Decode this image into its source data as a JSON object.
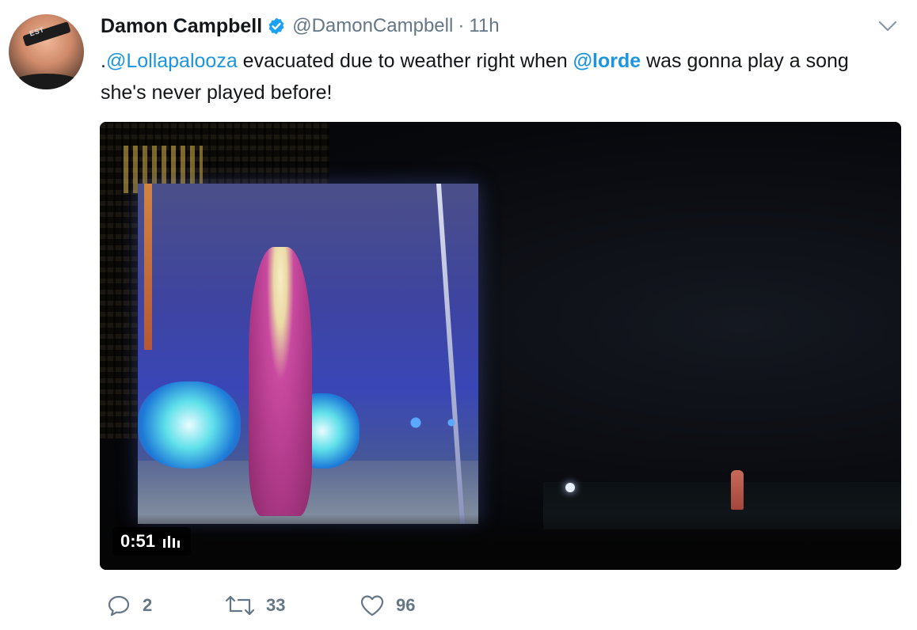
{
  "tweet": {
    "author": {
      "display_name": "Damon Campbell",
      "handle": "@DamonCampbell",
      "verified": true,
      "avatar_band_text": "EST"
    },
    "separator": "·",
    "timestamp": "11h",
    "text": {
      "prefix": ".",
      "mention1": "@Lollapalooza",
      "part2": " evacuated due to weather right when ",
      "mention2": "@lorde",
      "part3": " was gonna play a song she's never played before!"
    },
    "media": {
      "type": "video",
      "duration": "0:51"
    },
    "actions": {
      "reply_count": "2",
      "retweet_count": "33",
      "like_count": "96"
    }
  },
  "colors": {
    "link": "#1b95e0",
    "secondary_text": "#657786",
    "verified_badge": "#1da1f2"
  },
  "icons": [
    "verified-icon",
    "chevron-down-icon",
    "audio-icon",
    "reply-icon",
    "retweet-icon",
    "like-icon"
  ]
}
